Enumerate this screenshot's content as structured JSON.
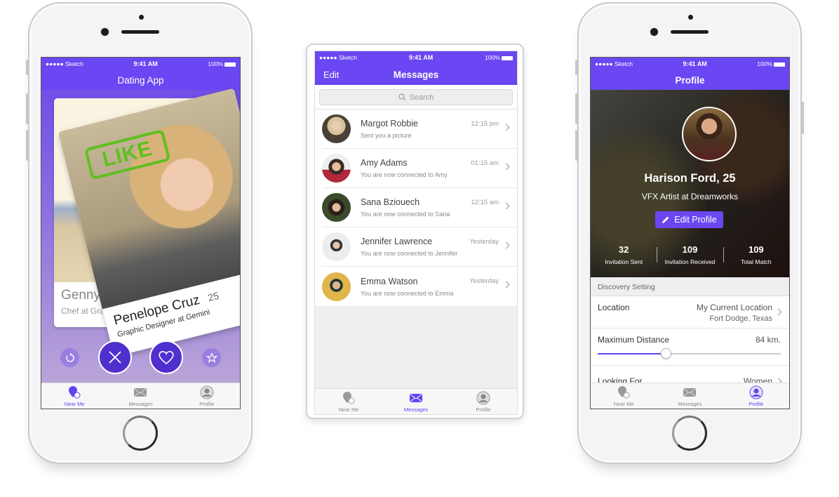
{
  "status_bar": {
    "carrier": "●●●●● Sketch",
    "time": "9:41 AM",
    "battery": "100%"
  },
  "colors": {
    "accent": "#6443ef",
    "like": "#5fbf1f"
  },
  "phone1": {
    "title": "Dating App",
    "back_card": {
      "name": "Genny Alt",
      "job": "Chef at Grand Bu"
    },
    "front_card": {
      "name": "Penelope Cruz",
      "age": "25",
      "job": "Graphic Designer at Gemini",
      "stamp": "LIKE"
    },
    "actions": [
      {
        "icon": "undo-icon"
      },
      {
        "icon": "close-icon"
      },
      {
        "icon": "heart-icon"
      },
      {
        "icon": "star-icon"
      }
    ],
    "tabs": [
      {
        "label": "Near Me",
        "active": true
      },
      {
        "label": "Messages"
      },
      {
        "label": "Profile"
      }
    ]
  },
  "phone2": {
    "edit": "Edit",
    "title": "Messages",
    "search_placeholder": "Search",
    "messages": [
      {
        "name": "Margot Robbie",
        "preview": "Sent you a picture",
        "time": "12:15 pm"
      },
      {
        "name": "Amy Adams",
        "preview": "You are now connected to Amy",
        "time": "01:15 am"
      },
      {
        "name": "Sana Bziouech",
        "preview": "You are now connected to Sana",
        "time": "12:15 am"
      },
      {
        "name": "Jennifer Lawrence",
        "preview": "You are now connected to Jennifer",
        "time": "Yesterday"
      },
      {
        "name": "Emma Watson",
        "preview": "You are now connected to Emma",
        "time": "Yesterday"
      }
    ],
    "tabs": [
      {
        "label": "Near Me"
      },
      {
        "label": "Messages",
        "active": true
      },
      {
        "label": "Profile"
      }
    ]
  },
  "phone3": {
    "title": "Profile",
    "name": "Harison Ford, 25",
    "job": "VFX Artist at Dreamworks",
    "edit_button": "Edit Profile",
    "stats": [
      {
        "value": "32",
        "label": "Invitation Sent"
      },
      {
        "value": "109",
        "label": "Invitation Received"
      },
      {
        "value": "109",
        "label": "Total Match"
      }
    ],
    "section": "Discovery Setting",
    "location_label": "Location",
    "location_value": "My Current Location",
    "location_sub": "Fort Dodge, Texas",
    "distance_label": "Maximum Distance",
    "distance_value": "84 km.",
    "distance_fraction": 0.37,
    "looking_label": "Looking For",
    "looking_value": "Women",
    "tabs": [
      {
        "label": "Near Me"
      },
      {
        "label": "Messages"
      },
      {
        "label": "Profile",
        "active": true
      }
    ]
  }
}
